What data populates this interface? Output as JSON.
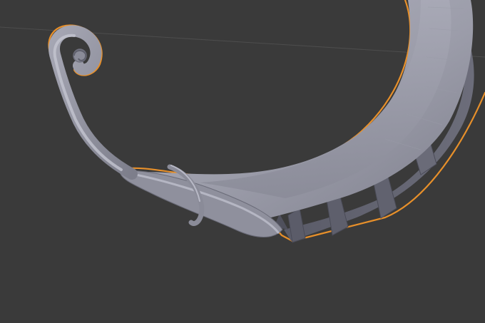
{
  "viewport": {
    "background_color": "#3a3a3a",
    "grid_line_color": "#4c4c4c",
    "mesh_base_color": "#8e8f9c",
    "mesh_shadow_color": "#555663",
    "mesh_highlight_color": "#b8b9c6",
    "selection_outline_color": "#e8902a",
    "selected_object": "curved-hook-mesh"
  }
}
